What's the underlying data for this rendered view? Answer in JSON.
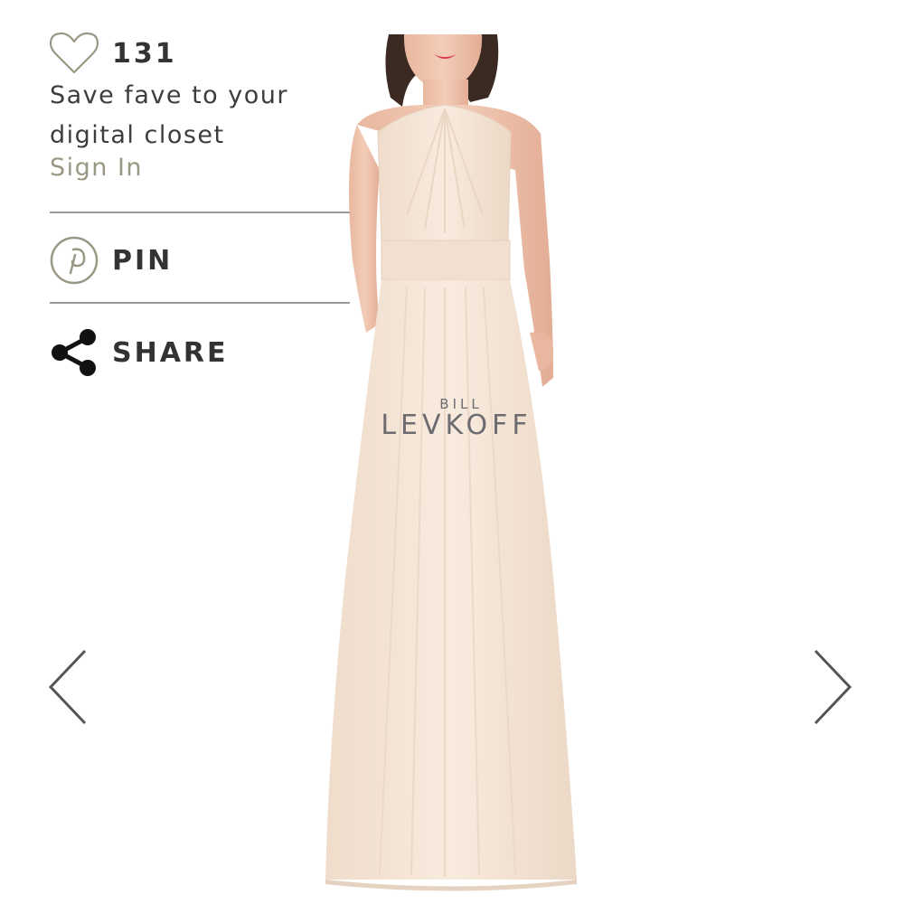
{
  "actions": {
    "fave_count": "131",
    "fave_text": "Save fave to your digital closet",
    "sign_in": "Sign In",
    "pin_label": "PIN",
    "share_label": "SHARE"
  },
  "product": {
    "brand_small": "BILL",
    "brand_large": "LEVKOFF",
    "dress_color": "#f6e6d6"
  },
  "icons": {
    "heart": "heart-icon",
    "pinterest": "pinterest-icon",
    "share": "share-icon",
    "prev": "chevron-left-icon",
    "next": "chevron-right-icon"
  },
  "colors": {
    "text": "#333333",
    "accent": "#9a9884",
    "divider": "#9a9a9a"
  }
}
